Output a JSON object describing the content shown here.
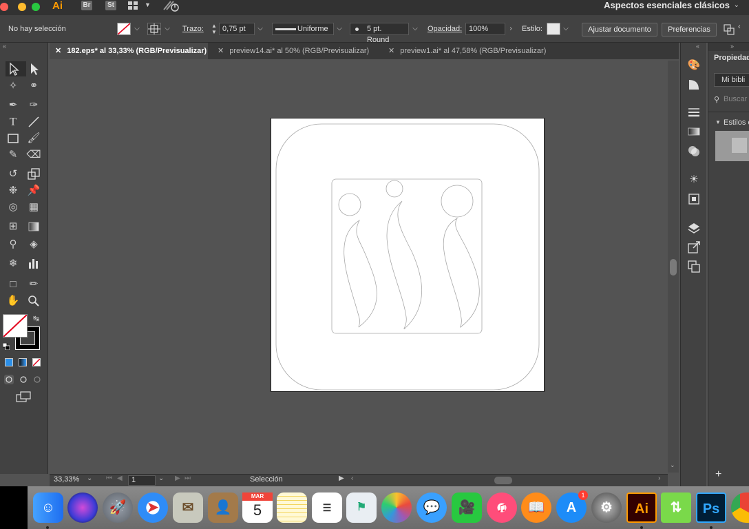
{
  "appbar": {
    "app_logo": "Ai",
    "bridge_badge": "Br",
    "stock_badge": "St",
    "workspace": "Aspectos esenciales clásicos"
  },
  "control": {
    "selection": "No hay selección",
    "stroke_label": "Trazo:",
    "stroke_value": "0,75 pt",
    "profile": "Uniforme",
    "brush": "5 pt. Round",
    "opacity_label": "Opacidad:",
    "opacity_value": "100%",
    "style_label": "Estilo:",
    "adjust_button": "Ajustar documento",
    "prefs_button": "Preferencias"
  },
  "tabs": [
    {
      "label": "182.eps* al 33,33% (RGB/Previsualizar)"
    },
    {
      "label": "preview14.ai* al 50% (RGB/Previsualizar)"
    },
    {
      "label": "preview1.ai* al 47,58% (RGB/Previsualizar)"
    }
  ],
  "rightpanel": {
    "title": "Propiedad",
    "library": "Mi bibli",
    "search": "Buscar",
    "styles": "Estilos c"
  },
  "status": {
    "zoom": "33,33%",
    "page": "1",
    "tool": "Selección"
  },
  "dock": {
    "calendar_month": "MAR",
    "calendar_day": "5",
    "appstore_badge": "1",
    "ai_label": "Ai",
    "ps_label": "Ps"
  },
  "colors": {
    "stroke": "#000000",
    "fill": "none",
    "accent": "#ff9a00"
  }
}
